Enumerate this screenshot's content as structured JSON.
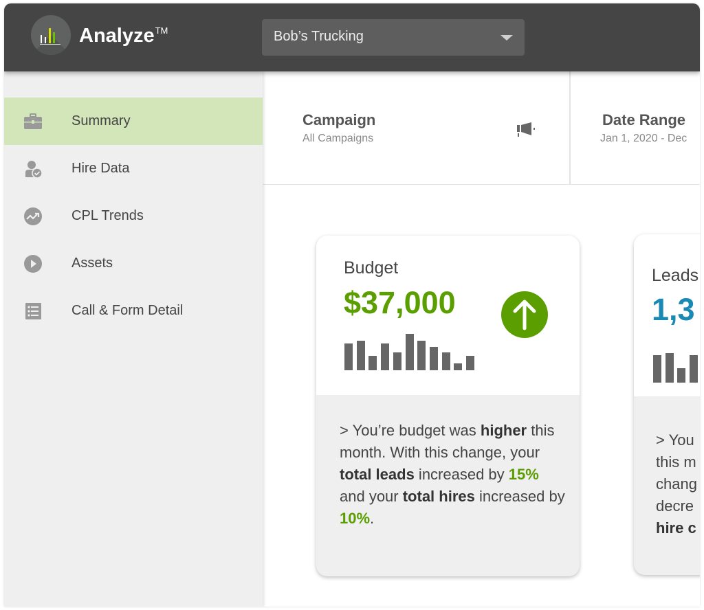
{
  "header": {
    "brand": "Analyze",
    "trademark": "TM",
    "account_selector": {
      "value": "Bob’s Trucking"
    },
    "logo_colors": [
      "#ffffff",
      "#d4e000",
      "#6cc000"
    ]
  },
  "sidebar": {
    "items": [
      {
        "label": "Summary",
        "icon": "briefcase-icon",
        "active": true
      },
      {
        "label": "Hire Data",
        "icon": "user-check-icon"
      },
      {
        "label": "CPL Trends",
        "icon": "trend-up-icon"
      },
      {
        "label": "Assets",
        "icon": "play-icon"
      },
      {
        "label": "Call & Form Detail",
        "icon": "list-icon"
      }
    ]
  },
  "filters": {
    "campaign": {
      "title": "Campaign",
      "value": "All Campaigns",
      "icon": "megaphone-icon"
    },
    "date_range": {
      "title": "Date Range",
      "value": "Jan 1, 2020 - Dec"
    }
  },
  "cards": [
    {
      "title": "Budget",
      "value": "$37,000",
      "value_color": "#5a9e00",
      "trend": "up",
      "trend_icon": "arrow-up-circle-icon",
      "sparkline": [
        39,
        43,
        21,
        39,
        26,
        53,
        43,
        34,
        26,
        10,
        21
      ],
      "text": {
        "p1": "> You’re budget was ",
        "b1": "higher",
        "p2": " this month. With this change, your ",
        "b2": "total leads",
        "p3": " increased by ",
        "g1": "15%",
        "p4": " and your ",
        "b3": "total hires",
        "p5": " increased by ",
        "g2": "10%",
        "p6": "."
      }
    },
    {
      "title": "Leads",
      "value": "1,3",
      "value_color": "#1a8ab4",
      "sparkline": [
        40,
        43,
        21,
        40
      ],
      "text_lines": [
        "> You",
        "this m",
        "chang",
        "decre"
      ],
      "text_bold": "hire c"
    }
  ],
  "colors": {
    "header_bg": "#454545",
    "sidebar_bg": "#efefef",
    "active_bg": "#d3e6b9",
    "accent_green": "#5a9e00",
    "accent_blue": "#1a8ab4"
  }
}
